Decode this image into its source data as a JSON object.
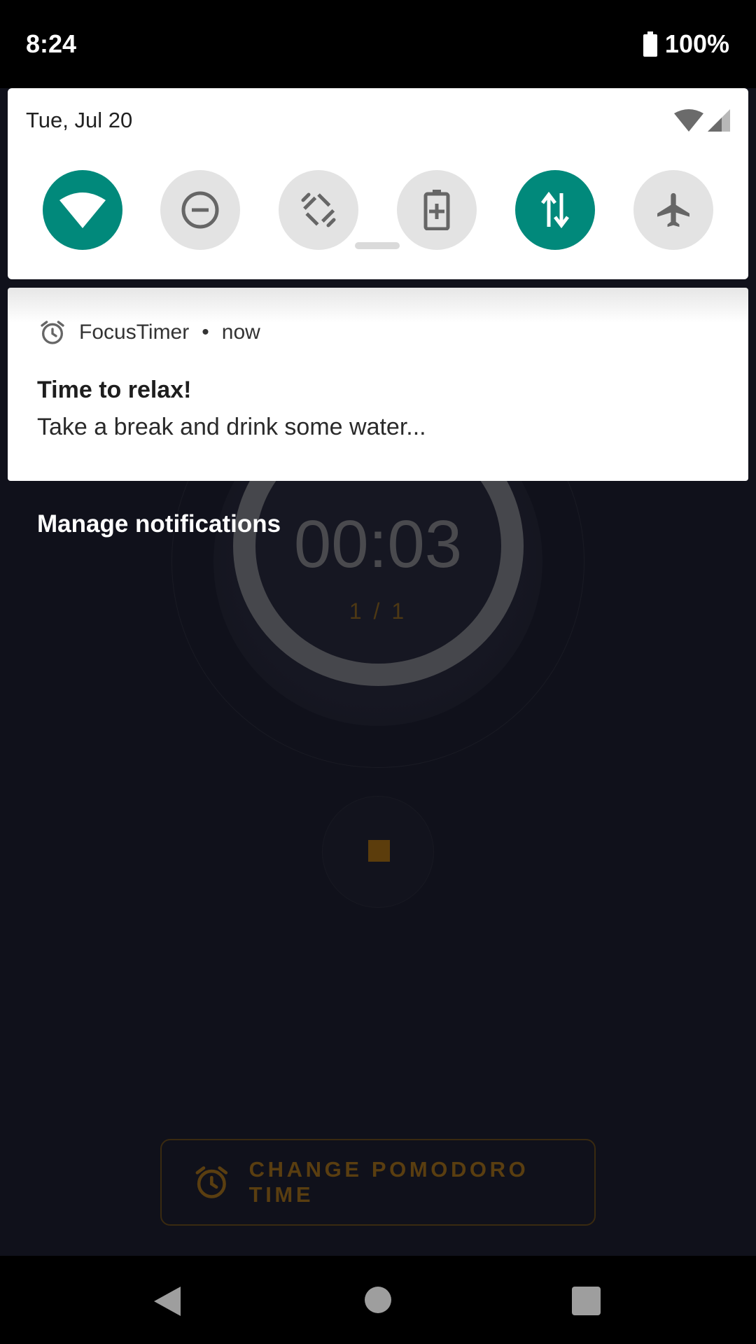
{
  "status_bar": {
    "time": "8:24",
    "battery": "100%"
  },
  "quick_settings": {
    "date": "Tue, Jul 20",
    "tiles": [
      {
        "name": "wifi",
        "icon": "wifi-icon",
        "state": "on"
      },
      {
        "name": "do-not-disturb",
        "icon": "dnd-icon",
        "state": "off"
      },
      {
        "name": "auto-rotate",
        "icon": "rotate-icon",
        "state": "off"
      },
      {
        "name": "battery-saver",
        "icon": "battery-saver-icon",
        "state": "off"
      },
      {
        "name": "mobile-data",
        "icon": "data-arrows-icon",
        "state": "on"
      },
      {
        "name": "airplane-mode",
        "icon": "airplane-icon",
        "state": "off"
      }
    ],
    "accent_color": "#01897b"
  },
  "notification": {
    "app_name": "FocusTimer",
    "time": "now",
    "title": "Time to relax!",
    "body": "Take a break and drink some water..."
  },
  "manage_notifications": "Manage notifications",
  "app": {
    "timer": "00:03",
    "session": "1 / 1",
    "change_button": "CHANGE POMODORO TIME",
    "accent_color": "#ff9800"
  }
}
